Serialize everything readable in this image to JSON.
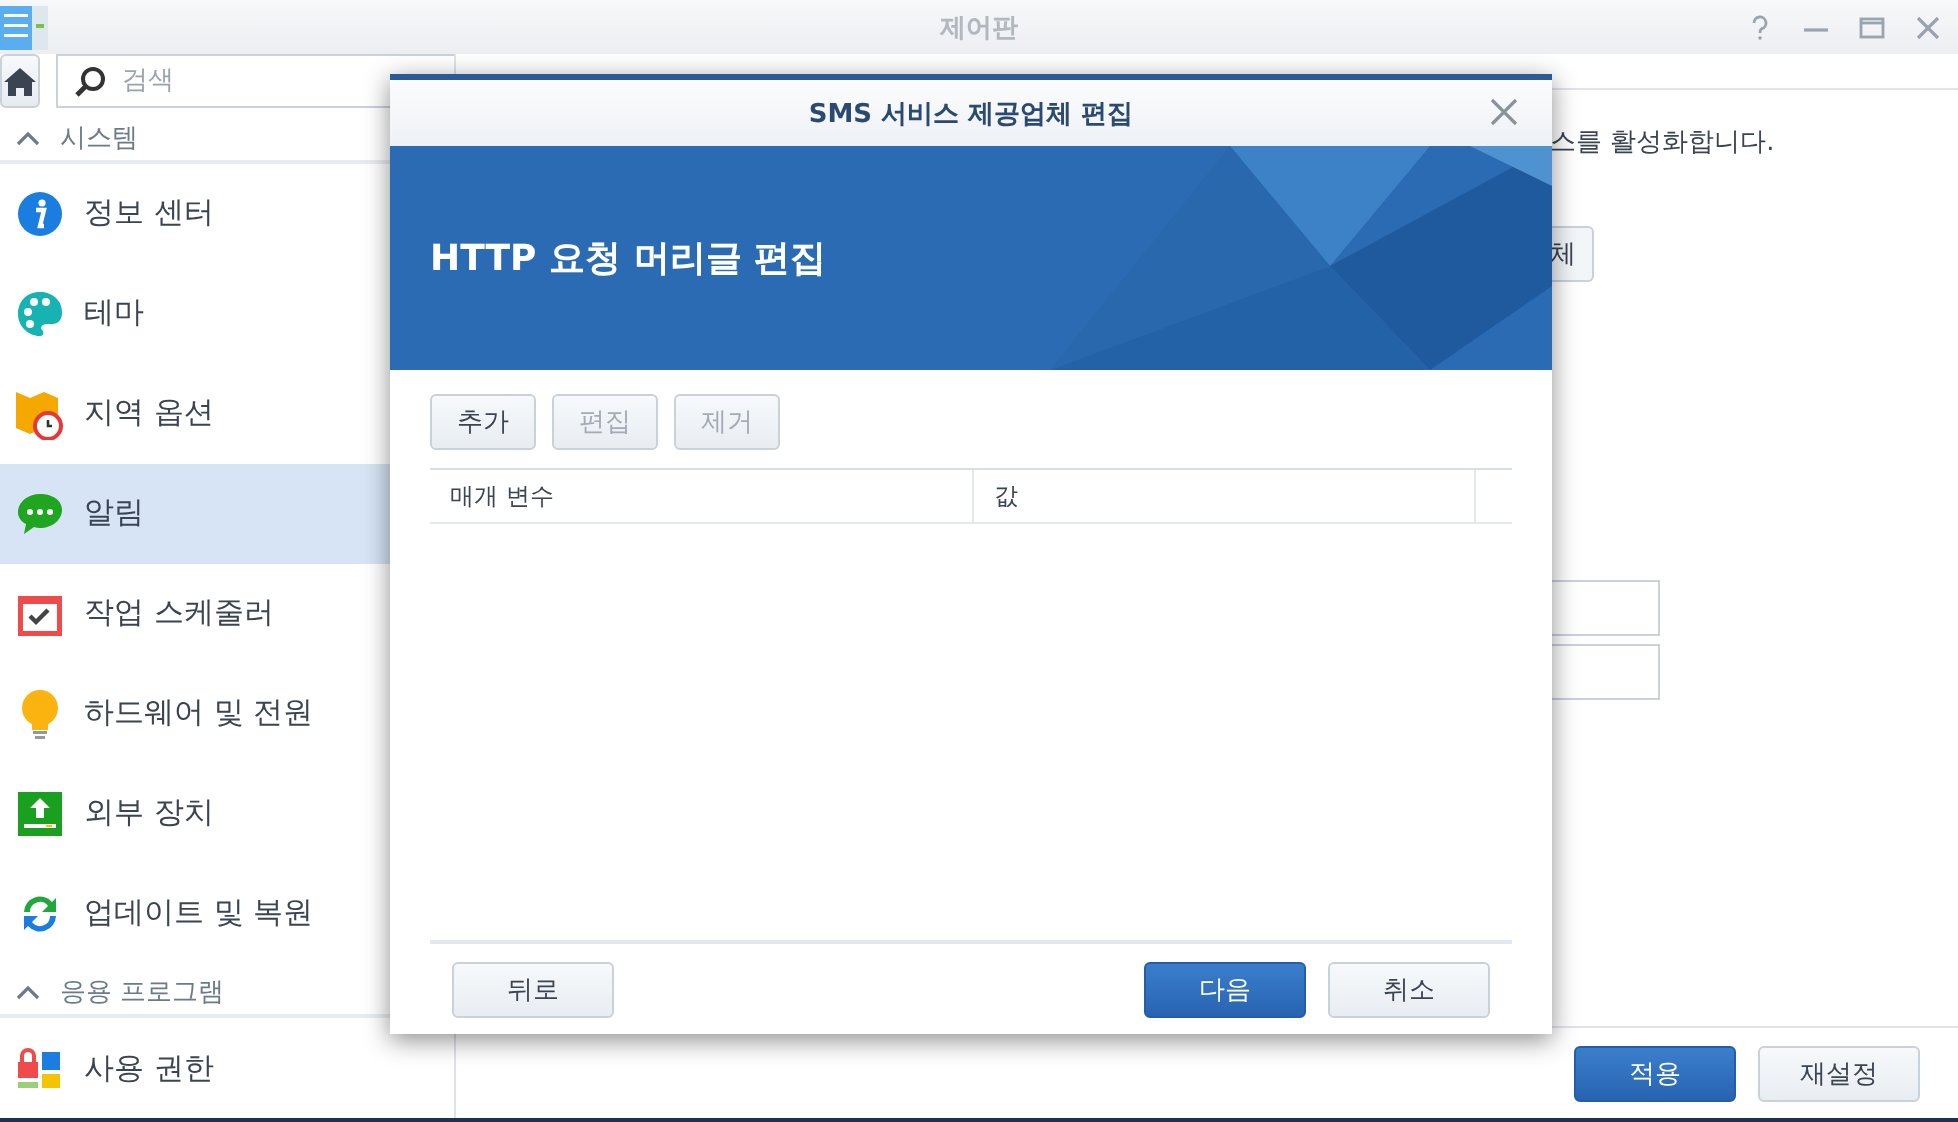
{
  "window": {
    "title": "제어판"
  },
  "search": {
    "placeholder": "검색"
  },
  "sidebar": {
    "sections": [
      {
        "title": "시스템",
        "expanded": true,
        "items": [
          {
            "label": "정보 센터",
            "selected": false
          },
          {
            "label": "테마",
            "selected": false
          },
          {
            "label": "지역 옵션",
            "selected": false
          },
          {
            "label": "알림",
            "selected": true
          },
          {
            "label": "작업 스케줄러",
            "selected": false
          },
          {
            "label": "하드웨어 및 전원",
            "selected": false
          },
          {
            "label": "외부 장치",
            "selected": false
          },
          {
            "label": "업데이트 및 복원",
            "selected": false
          }
        ]
      },
      {
        "title": "응용 프로그램",
        "expanded": true,
        "items": [
          {
            "label": "사용 권한",
            "selected": false
          }
        ]
      }
    ]
  },
  "main": {
    "description_tail": "스를 활성화합니다.",
    "button_tail": "체",
    "buttons": [
      {
        "label": "적용",
        "kind": "primary"
      },
      {
        "label": "재설정",
        "kind": "default"
      }
    ]
  },
  "dialog": {
    "title": "SMS 서비스 제공업체 편집",
    "banner": "HTTP 요청 머리글 편집",
    "toolbar": [
      {
        "label": "추가",
        "disabled": false
      },
      {
        "label": "편집",
        "disabled": true
      },
      {
        "label": "제거",
        "disabled": true
      }
    ],
    "table": {
      "columns": [
        "매개 변수",
        "값"
      ]
    },
    "footer": {
      "left": [
        {
          "label": "뒤로",
          "kind": "default"
        }
      ],
      "right": [
        {
          "label": "다음",
          "kind": "primary"
        },
        {
          "label": "취소",
          "kind": "default"
        }
      ]
    }
  }
}
